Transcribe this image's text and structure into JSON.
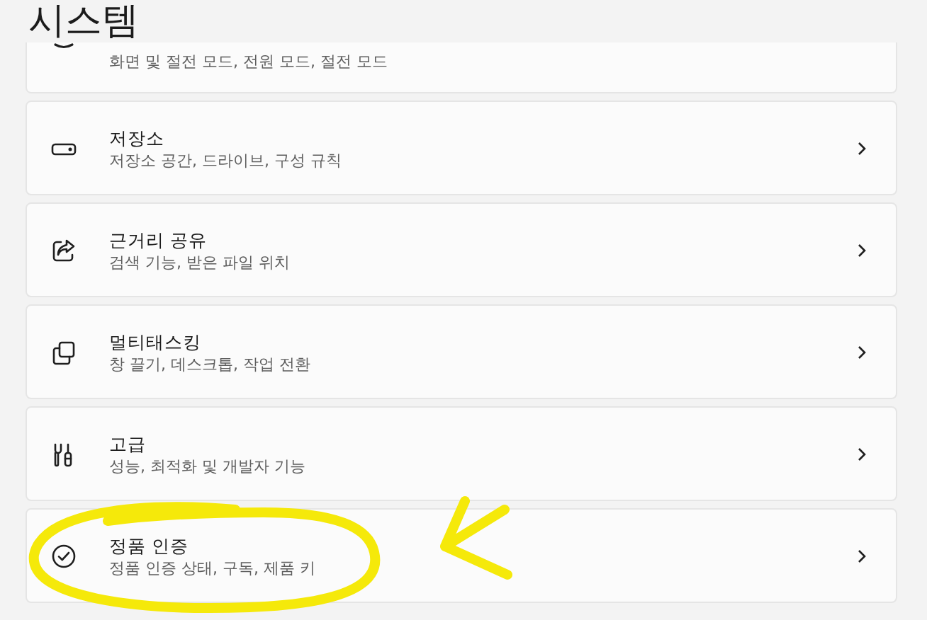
{
  "title": "시스템",
  "items": [
    {
      "kind": "power",
      "subtitle": "화면 및 절전 모드, 전원 모드, 절전 모드"
    },
    {
      "kind": "storage",
      "title": "저장소",
      "subtitle": "저장소 공간, 드라이브, 구성 규칙"
    },
    {
      "kind": "share",
      "title": "근거리 공유",
      "subtitle": "검색 기능, 받은 파일 위치"
    },
    {
      "kind": "multitask",
      "title": "멀티태스킹",
      "subtitle": "창 끌기, 데스크톱, 작업 전환"
    },
    {
      "kind": "tools",
      "title": "고급",
      "subtitle": "성능, 최적화 및 개발자 기능"
    },
    {
      "kind": "check",
      "title": "정품 인증",
      "subtitle": "정품 인증 상태, 구독, 제품 키"
    }
  ],
  "highlight": {
    "color": "#f5e90a"
  },
  "arrow": {
    "color": "#f5e90a"
  }
}
